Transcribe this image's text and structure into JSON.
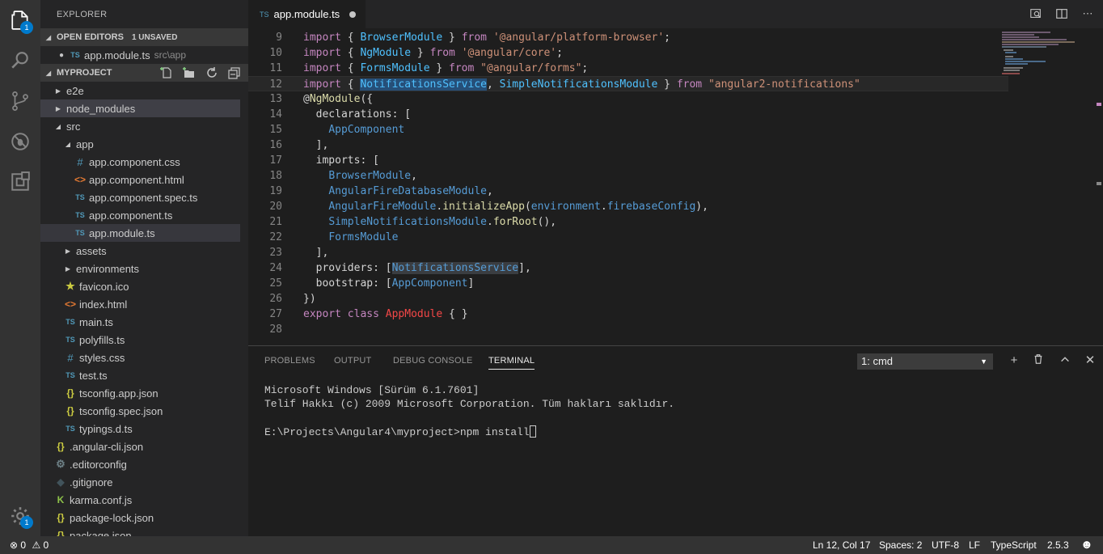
{
  "activity": {
    "explorer_badge": "1",
    "settings_badge": "1"
  },
  "sidebar": {
    "title": "EXPLORER",
    "open_editors": {
      "label": "OPEN EDITORS",
      "unsaved": "1 UNSAVED",
      "item_icon": "TS",
      "item_name": "app.module.ts",
      "item_path": "src\\app"
    },
    "project": {
      "label": "MYPROJECT",
      "items": [
        {
          "name": "e2e",
          "type": "folder",
          "state": "closed",
          "icon": ""
        },
        {
          "name": "node_modules",
          "type": "folder",
          "state": "closed",
          "icon": ""
        },
        {
          "name": "src",
          "type": "folder",
          "state": "open",
          "icon": ""
        },
        {
          "name": "app",
          "type": "folder",
          "state": "open",
          "icon": ""
        },
        {
          "name": "app.component.css",
          "type": "file",
          "icon": "#"
        },
        {
          "name": "app.component.html",
          "type": "file",
          "icon": "<>"
        },
        {
          "name": "app.component.spec.ts",
          "type": "file",
          "icon": "TS"
        },
        {
          "name": "app.component.ts",
          "type": "file",
          "icon": "TS"
        },
        {
          "name": "app.module.ts",
          "type": "file",
          "icon": "TS"
        },
        {
          "name": "assets",
          "type": "folder",
          "state": "closed",
          "icon": ""
        },
        {
          "name": "environments",
          "type": "folder",
          "state": "closed",
          "icon": ""
        },
        {
          "name": "favicon.ico",
          "type": "file",
          "icon": "★"
        },
        {
          "name": "index.html",
          "type": "file",
          "icon": "<>"
        },
        {
          "name": "main.ts",
          "type": "file",
          "icon": "TS"
        },
        {
          "name": "polyfills.ts",
          "type": "file",
          "icon": "TS"
        },
        {
          "name": "styles.css",
          "type": "file",
          "icon": "#"
        },
        {
          "name": "test.ts",
          "type": "file",
          "icon": "TS"
        },
        {
          "name": "tsconfig.app.json",
          "type": "file",
          "icon": "{}"
        },
        {
          "name": "tsconfig.spec.json",
          "type": "file",
          "icon": "{}"
        },
        {
          "name": "typings.d.ts",
          "type": "file",
          "icon": "TS"
        },
        {
          "name": ".angular-cli.json",
          "type": "file",
          "icon": "{}"
        },
        {
          "name": ".editorconfig",
          "type": "file",
          "icon": "⚙"
        },
        {
          "name": ".gitignore",
          "type": "file",
          "icon": "◆"
        },
        {
          "name": "karma.conf.js",
          "type": "file",
          "icon": "K"
        },
        {
          "name": "package-lock.json",
          "type": "file",
          "icon": "{}"
        },
        {
          "name": "package.json",
          "type": "file",
          "icon": "{}"
        }
      ]
    }
  },
  "editor": {
    "tab_icon": "TS",
    "tab_label": "app.module.ts",
    "line_numbers": [
      "9",
      "10",
      "11",
      "12",
      "13",
      "14",
      "15",
      "16",
      "17",
      "18",
      "19",
      "20",
      "21",
      "22",
      "23",
      "24",
      "25",
      "26",
      "27",
      "28"
    ]
  },
  "panel": {
    "tabs": [
      "PROBLEMS",
      "OUTPUT",
      "DEBUG CONSOLE",
      "TERMINAL"
    ],
    "terminal_select": "1: cmd",
    "terminal_lines": [
      "Microsoft Windows [Sürüm 6.1.7601]",
      "Telif Hakkı (c) 2009 Microsoft Corporation. Tüm hakları saklıdır.",
      "",
      "E:\\Projects\\Angular4\\myproject>npm install"
    ]
  },
  "status": {
    "errors": "0",
    "warnings": "0",
    "position": "Ln 12, Col 17",
    "spaces": "Spaces: 2",
    "encoding": "UTF-8",
    "eol": "LF",
    "language": "TypeScript",
    "version": "2.5.3"
  },
  "colors": {
    "activity_bar": "#333333",
    "sidebar": "#252526",
    "editor": "#1e1e1e",
    "accent": "#007acc",
    "status_bar": "#333333"
  }
}
